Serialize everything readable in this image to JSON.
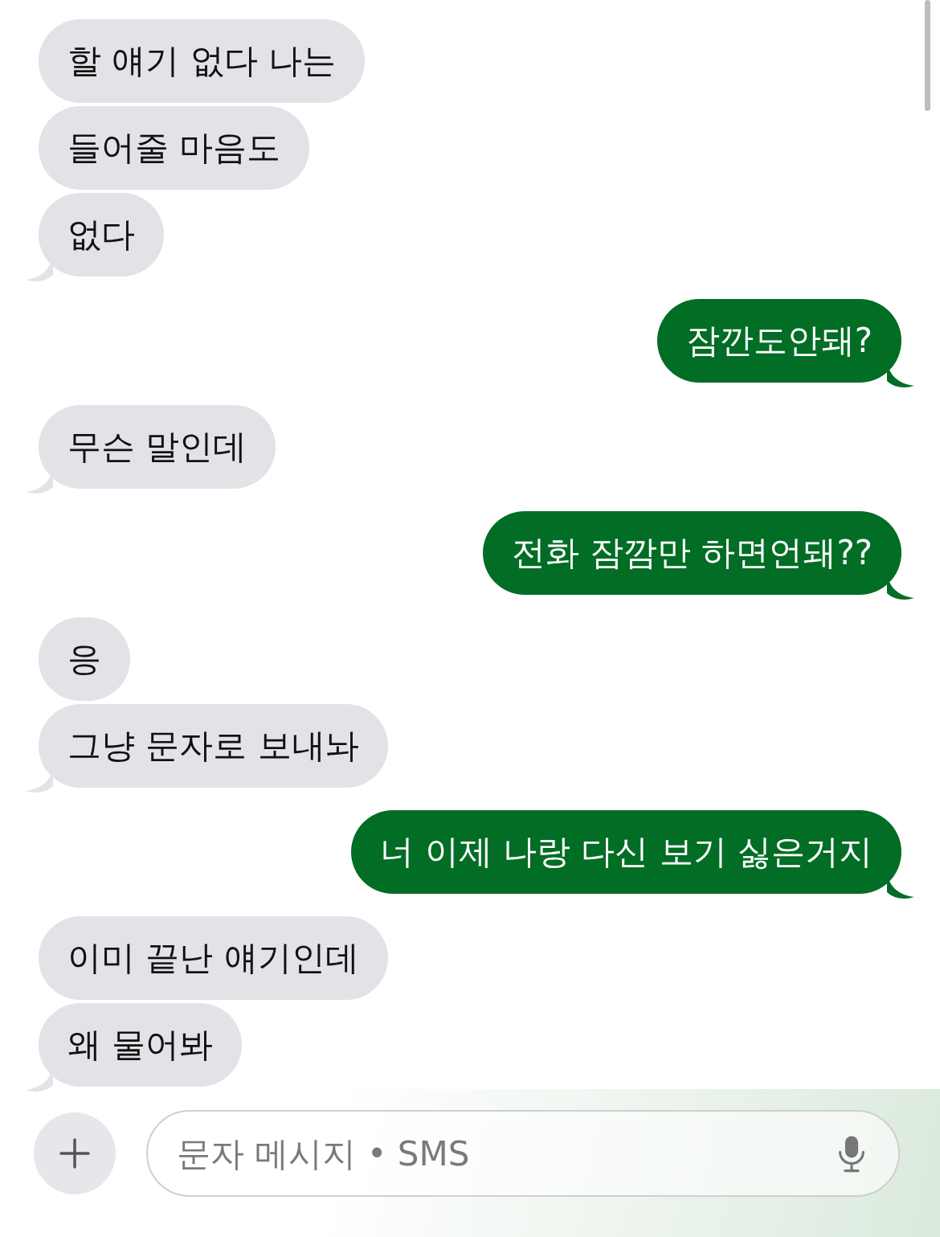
{
  "messages": [
    {
      "kind": "received",
      "text": "할 얘기 없다 나는",
      "tail": false
    },
    {
      "kind": "received",
      "text": "들어줄 마음도",
      "tail": false
    },
    {
      "kind": "received",
      "text": "없다",
      "tail": true
    },
    {
      "kind": "sent",
      "text": "잠깐도안돼?",
      "tail": true
    },
    {
      "kind": "received",
      "text": "무슨 말인데",
      "tail": true
    },
    {
      "kind": "sent",
      "text": "전화 잠깜만 하면언돼??",
      "tail": true
    },
    {
      "kind": "received",
      "text": "응",
      "tail": false
    },
    {
      "kind": "received",
      "text": "그냥 문자로 보내놔",
      "tail": true
    },
    {
      "kind": "sent",
      "text": "너 이제 나랑 다신 보기 싫은거지",
      "tail": true
    },
    {
      "kind": "received",
      "text": "이미 끝난 얘기인데",
      "tail": false
    },
    {
      "kind": "received",
      "text": "왜 물어봐",
      "tail": true
    }
  ],
  "composer": {
    "placeholder": "문자 메시지 • SMS"
  }
}
